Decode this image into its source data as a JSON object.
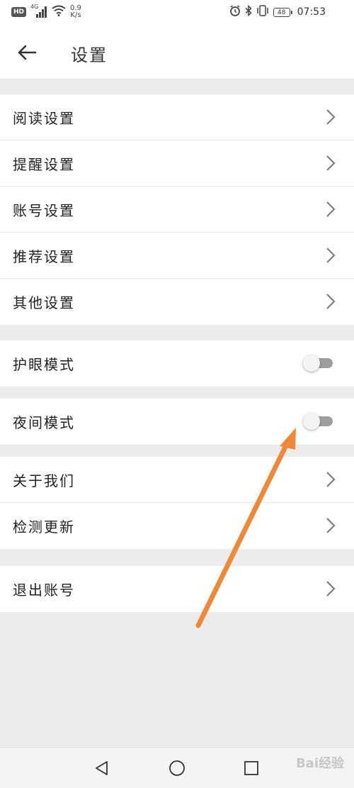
{
  "status_bar": {
    "hd": "HD",
    "signal_label": "4G",
    "net_speed": "0.9",
    "net_unit": "K/s",
    "battery": "48",
    "time": "07:53",
    "icons": [
      "hd-icon",
      "signal-icon",
      "wifi-icon",
      "alarm-icon",
      "bluetooth-icon",
      "vibrate-icon",
      "battery-icon"
    ]
  },
  "header": {
    "title": "设置",
    "back_icon": "back-arrow-icon"
  },
  "groups": {
    "settings": [
      {
        "label": "阅读设置"
      },
      {
        "label": "提醒设置"
      },
      {
        "label": "账号设置"
      },
      {
        "label": "推荐设置"
      },
      {
        "label": "其他设置"
      }
    ],
    "eye_mode": {
      "label": "护眼模式",
      "enabled": false
    },
    "night_mode": {
      "label": "夜间模式",
      "enabled": false
    },
    "about": [
      {
        "label": "关于我们"
      },
      {
        "label": "检测更新"
      }
    ],
    "logout": {
      "label": "退出账号"
    }
  },
  "nav_bar": {
    "icons": [
      "nav-back-icon",
      "nav-home-icon",
      "nav-recent-icon"
    ]
  },
  "watermark": {
    "text": "Bai经验"
  },
  "colors": {
    "background": "#ececec",
    "surface": "#ffffff",
    "annotation_arrow": "#f0883a",
    "toggle_off_track": "#9e9e9e"
  }
}
